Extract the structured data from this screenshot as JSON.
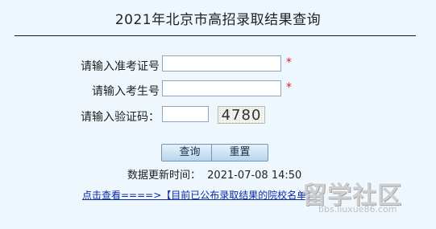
{
  "page": {
    "title": "2021年北京市高招录取结果查询"
  },
  "form": {
    "exam_id": {
      "label": "请输入准考证号",
      "value": "",
      "required_mark": "*"
    },
    "candidate_id": {
      "label": "请输入考生号",
      "value": "",
      "required_mark": "*"
    },
    "captcha": {
      "label": "请输入验证码：",
      "value": "",
      "image_text": "4780"
    }
  },
  "buttons": {
    "query_label": "查询",
    "reset_label": "重置"
  },
  "update_info": {
    "label": "数据更新时间：",
    "time": "2021-07-08 14:50"
  },
  "link": {
    "text": "点击查看====>【目前已公布录取结果的院校名单】"
  },
  "watermark": {
    "logo_text": "留学社区",
    "url": "bbs.liuxue86.com"
  },
  "colors": {
    "background": "#eef7fd",
    "required": "#e02020",
    "link": "#0a2aa8"
  }
}
